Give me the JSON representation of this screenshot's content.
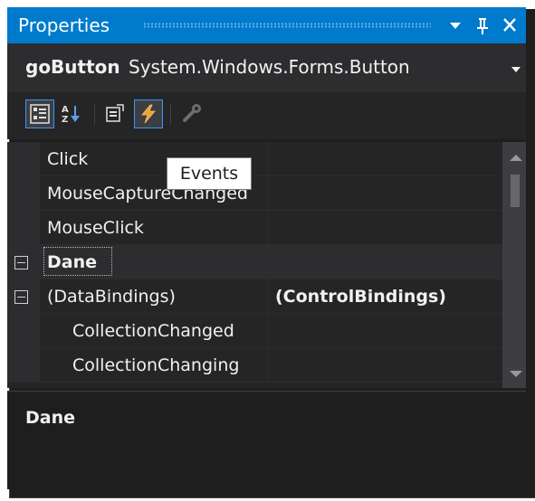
{
  "panel": {
    "title": "Properties",
    "dropdown_icon": "dropdown-arrow-icon",
    "pin_icon": "pin-icon",
    "close_icon": "close-icon"
  },
  "selector": {
    "object_name": "goButton",
    "object_type": "System.Windows.Forms.Button"
  },
  "toolbar": {
    "buttons": [
      {
        "icon": "categorized-icon",
        "active": true
      },
      {
        "icon": "alphabetical-icon",
        "active": false
      },
      {
        "icon": "properties-icon",
        "active": false
      },
      {
        "icon": "events-icon",
        "active": true
      },
      {
        "icon": "property-pages-icon",
        "active": false
      }
    ],
    "tooltip": "Events"
  },
  "grid": {
    "rows": [
      {
        "type": "property",
        "name": "Click",
        "value": ""
      },
      {
        "type": "property",
        "name": "MouseCaptureChanged",
        "value": ""
      },
      {
        "type": "property",
        "name": "MouseClick",
        "value": ""
      },
      {
        "type": "category",
        "name": "Dane",
        "expanded": true
      },
      {
        "type": "group",
        "name": "(DataBindings)",
        "value": "(ControlBindings)",
        "expanded": true
      },
      {
        "type": "subproperty",
        "name": "CollectionChanged",
        "value": ""
      },
      {
        "type": "subproperty",
        "name": "CollectionChanging",
        "value": ""
      }
    ]
  },
  "description": {
    "title": "Dane"
  },
  "colors": {
    "accent": "#007acc",
    "background": "#252526",
    "text": "#f1f1f1"
  }
}
